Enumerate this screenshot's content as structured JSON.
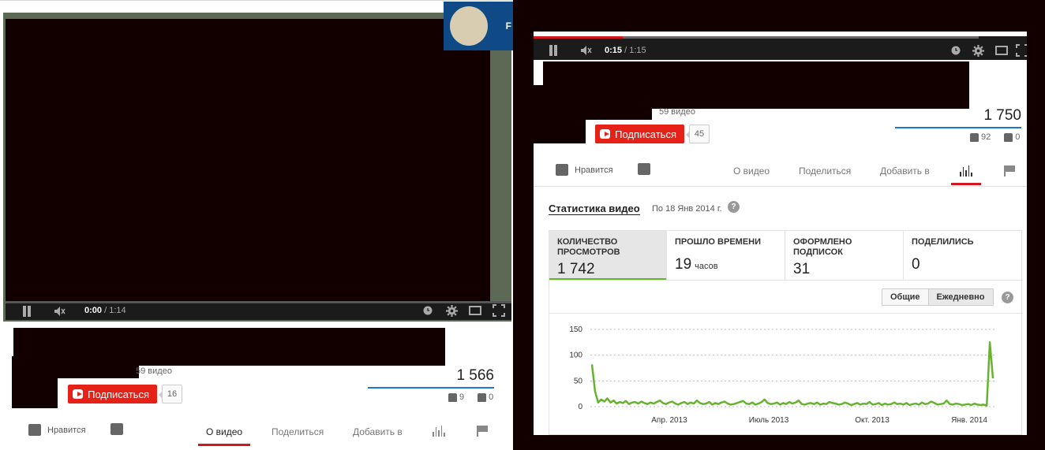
{
  "left_player": {
    "time_current": "0:00",
    "time_sep": " / ",
    "time_total": "1:14",
    "thumb_letter": "F",
    "video_count": "59 видео",
    "subscribe_label": "Подписаться",
    "subscriber_count": "16",
    "views": "1 566",
    "likes": "9",
    "dislikes": "0",
    "like_label": "Нравится",
    "tabs": {
      "about": "О видео",
      "share": "Поделиться",
      "add": "Добавить в"
    }
  },
  "right_player": {
    "time_current": "0:15",
    "time_sep": " / ",
    "time_total": "1:15",
    "progress_fraction": 0.2,
    "video_count": "59 видео",
    "subscribe_label": "Подписаться",
    "subscriber_count": "45",
    "views": "1 750",
    "likes": "92",
    "dislikes": "0",
    "like_label": "Нравится",
    "tabs": {
      "about": "О видео",
      "share": "Поделиться",
      "add": "Добавить в"
    }
  },
  "stats": {
    "title": "Статистика видео",
    "date_note": "По 18 Янв 2014 г.",
    "help": "?",
    "metrics": [
      {
        "label": "Количество просмотров",
        "value": "1 742",
        "unit": ""
      },
      {
        "label": "Прошло времени",
        "value": "19",
        "unit": "часов"
      },
      {
        "label": "Оформлено подписок",
        "value": "31",
        "unit": ""
      },
      {
        "label": "Поделились",
        "value": "0",
        "unit": ""
      }
    ],
    "toggle": {
      "total": "Общие",
      "daily": "Ежедневно"
    }
  },
  "colors": {
    "accent_red": "#cc181e",
    "subscribe_red": "#e62117",
    "line_green": "#66b32e",
    "view_bar_blue": "#167ac6"
  },
  "chart_data": {
    "type": "line",
    "ylim": [
      0,
      150
    ],
    "yticks": [
      "0",
      "50",
      "100",
      "150"
    ],
    "xticks": [
      "Апр. 2013",
      "Июль 2013",
      "Окт. 2013",
      "Янв. 2014"
    ],
    "series": [
      {
        "values": [
          82,
          30,
          8,
          14,
          10,
          16,
          8,
          12,
          6,
          9,
          7,
          11,
          5,
          8,
          9,
          6,
          10,
          7,
          5,
          8,
          6,
          9,
          12,
          7,
          5,
          8,
          10,
          6,
          4,
          7,
          9,
          5,
          8,
          6,
          12,
          7,
          5,
          6,
          9,
          4,
          7,
          5,
          8,
          10,
          6,
          4,
          5,
          7,
          9,
          11,
          6,
          5,
          8,
          4,
          6,
          9,
          14,
          7,
          5,
          6,
          8,
          4,
          7,
          5,
          9,
          6,
          8,
          12,
          5,
          4,
          6,
          7,
          5,
          8,
          4,
          6,
          5,
          9,
          7,
          6,
          4,
          5,
          8,
          6,
          3,
          5,
          7,
          4,
          6,
          5,
          9,
          4,
          5,
          7,
          3,
          6,
          4,
          5,
          8,
          5,
          6,
          4,
          7,
          3,
          5,
          6,
          4,
          8,
          5,
          6,
          10,
          7,
          4,
          5,
          6,
          12,
          5,
          4,
          6,
          5,
          3,
          4,
          5,
          3,
          6,
          4,
          3,
          4,
          2,
          125,
          55
        ]
      }
    ]
  }
}
